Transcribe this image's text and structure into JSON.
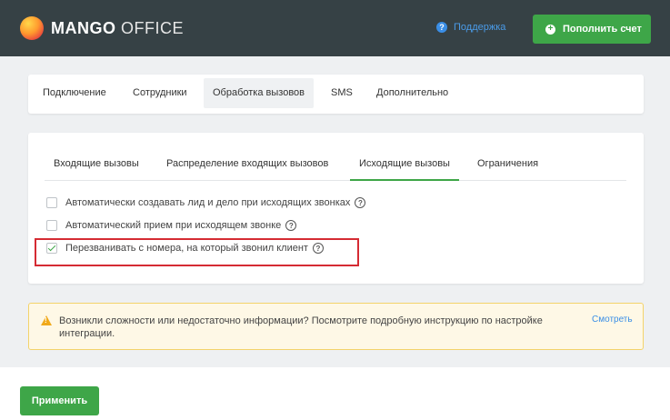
{
  "header": {
    "logo_bold": "MANGO",
    "logo_light": " OFFICE",
    "support_label": "Поддержка",
    "topup_label": "Пополнить счет"
  },
  "nav": {
    "items": [
      {
        "label": "Подключение"
      },
      {
        "label": "Сотрудники"
      },
      {
        "label": "Обработка вызовов",
        "active": true
      },
      {
        "label": "SMS"
      },
      {
        "label": "Дополнительно"
      }
    ]
  },
  "subtabs": {
    "items": [
      {
        "label": "Входящие вызовы"
      },
      {
        "label": "Распределение входящих вызовов"
      },
      {
        "label": "Исходящие вызовы",
        "active": true
      },
      {
        "label": "Ограничения"
      }
    ]
  },
  "options": [
    {
      "label": "Автоматически создавать лид и дело при исходящих звонках",
      "checked": false
    },
    {
      "label": "Автоматический прием при исходящем звонке",
      "checked": false
    },
    {
      "label": "Перезванивать с номера, на который звонил клиент",
      "checked": true
    }
  ],
  "warning": {
    "text": "Возникли сложности или недостаточно информации? Посмотрите подробную инструкцию по настройке интеграции.",
    "link": "Смотреть"
  },
  "footer": {
    "apply_label": "Применить"
  },
  "colors": {
    "header_bg": "#364145",
    "accent_green": "#3ea648",
    "link_blue": "#3a8ee6",
    "highlight_red": "#d52b33",
    "warning_bg": "#fef8e6"
  }
}
